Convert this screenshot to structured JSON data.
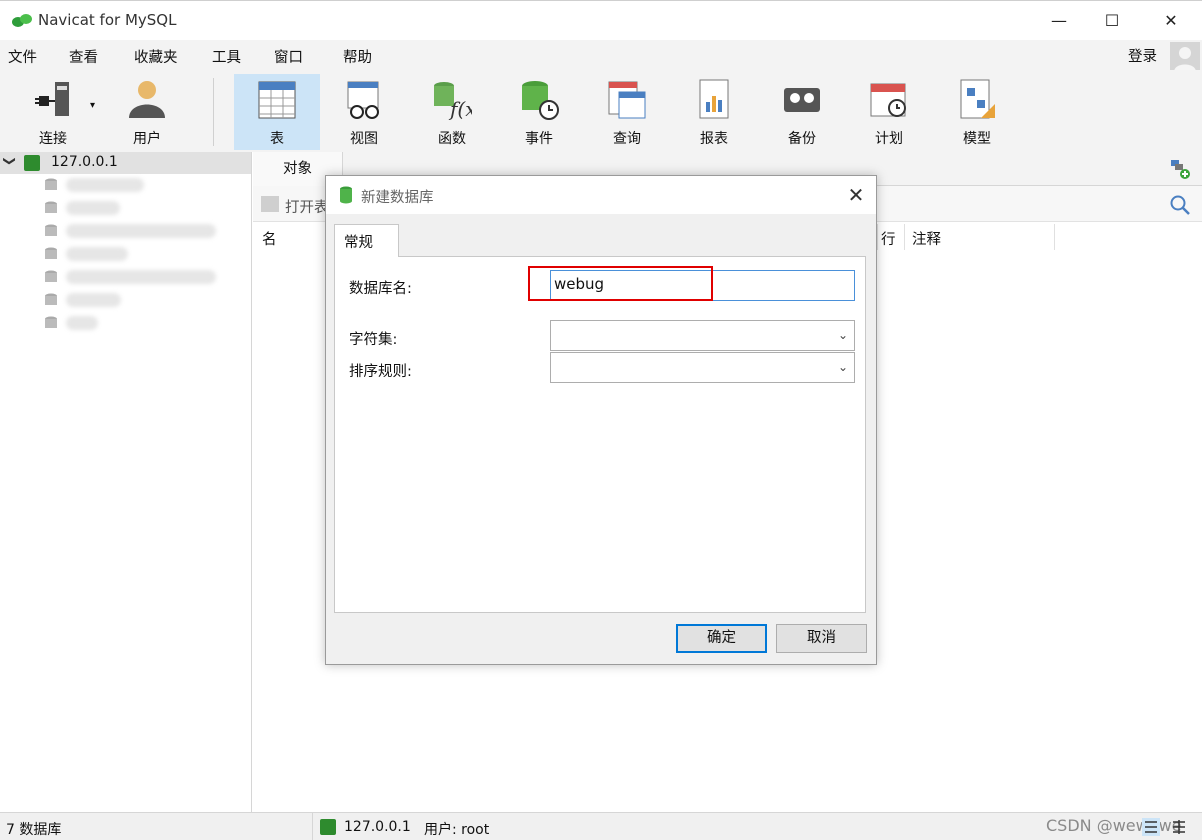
{
  "window": {
    "title": "Navicat for MySQL",
    "minimize_glyph": "—",
    "maximize_glyph": "☐",
    "close_glyph": "✕"
  },
  "menu": {
    "items": [
      "文件",
      "查看",
      "收藏夹",
      "工具",
      "窗口",
      "帮助"
    ],
    "login_label": "登录"
  },
  "toolbar": {
    "tools": [
      {
        "label": "连接",
        "icon": "connection-plug-icon"
      },
      {
        "label": "用户",
        "icon": "user-icon"
      },
      {
        "label": "表",
        "icon": "table-icon",
        "active": true
      },
      {
        "label": "视图",
        "icon": "view-glasses-icon"
      },
      {
        "label": "函数",
        "icon": "function-fx-icon"
      },
      {
        "label": "事件",
        "icon": "event-db-clock-icon"
      },
      {
        "label": "查询",
        "icon": "query-grid-icon"
      },
      {
        "label": "报表",
        "icon": "report-chart-icon"
      },
      {
        "label": "备份",
        "icon": "backup-tape-icon"
      },
      {
        "label": "计划",
        "icon": "schedule-calendar-icon"
      },
      {
        "label": "模型",
        "icon": "model-diagram-icon"
      }
    ]
  },
  "tree": {
    "root_label": "127.0.0.1",
    "expand_glyph": "❯"
  },
  "main": {
    "tab_label": "对象",
    "open_table_label": "打开表",
    "columns": [
      "名",
      "行",
      "注释"
    ]
  },
  "dialog": {
    "title": "新建数据库",
    "close_glyph": "✕",
    "tab_label": "常规",
    "dbname_label": "数据库名:",
    "dbname_value": "webug",
    "charset_label": "字符集:",
    "collation_label": "排序规则:",
    "ok_label": "确定",
    "cancel_label": "取消",
    "caret_glyph": "⌄"
  },
  "status": {
    "db_count": "7 数据库",
    "connection": "127.0.0.1",
    "user": "用户: root",
    "watermark": "CSDN @wewewe"
  },
  "colors": {
    "accent": "#0078d7",
    "active_tool": "#cce4f7",
    "highlight": "#e00000"
  }
}
